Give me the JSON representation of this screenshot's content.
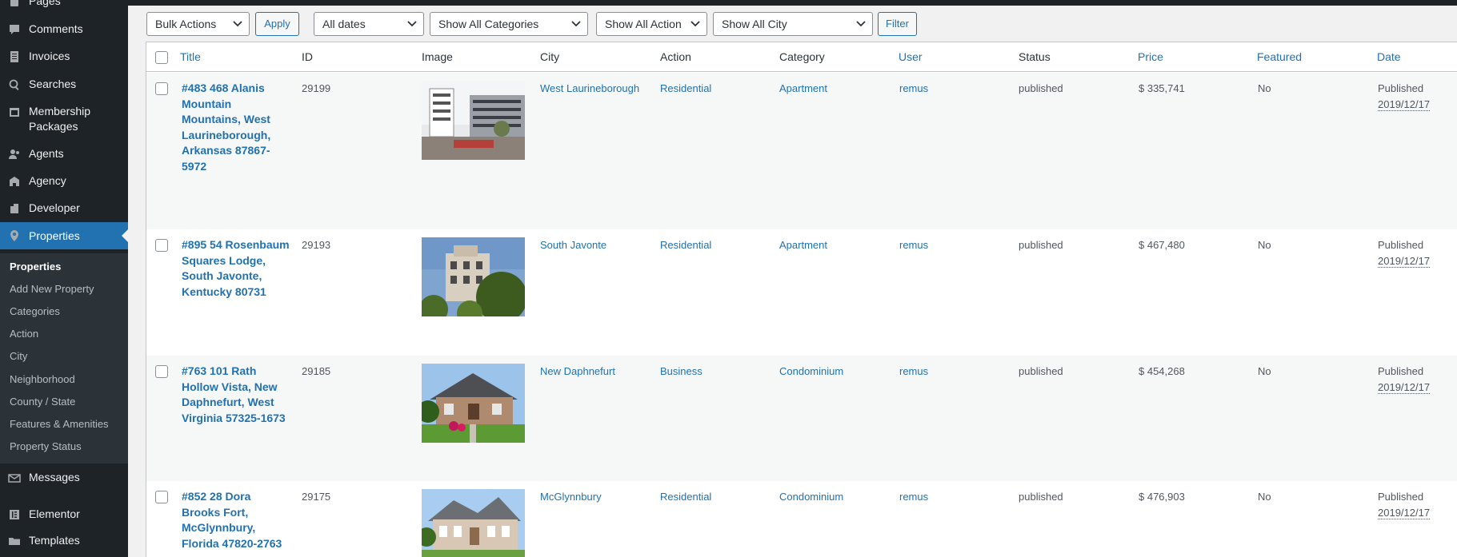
{
  "sidebar": {
    "items": [
      {
        "label": "Pages",
        "icon": "pages-icon"
      },
      {
        "label": "Comments",
        "icon": "comments-icon"
      },
      {
        "label": "Invoices",
        "icon": "invoices-icon"
      },
      {
        "label": "Searches",
        "icon": "search-icon"
      },
      {
        "label": "Membership Packages",
        "icon": "calendar-icon"
      },
      {
        "label": "Agents",
        "icon": "agents-icon"
      },
      {
        "label": "Agency",
        "icon": "agency-icon"
      },
      {
        "label": "Developer",
        "icon": "developer-icon"
      },
      {
        "label": "Properties",
        "icon": "location-pin-icon"
      },
      {
        "label": "Messages",
        "icon": "messages-icon"
      },
      {
        "label": "Elementor",
        "icon": "elementor-icon"
      },
      {
        "label": "Templates",
        "icon": "folder-icon"
      }
    ],
    "submenu": [
      "Properties",
      "Add New Property",
      "Categories",
      "Action",
      "City",
      "Neighborhood",
      "County / State",
      "Features & Amenities",
      "Property Status"
    ]
  },
  "toolbar": {
    "bulk_actions": "Bulk Actions",
    "apply": "Apply",
    "dates": "All dates",
    "categories": "Show All Categories",
    "action": "Show All Action",
    "city": "Show All City",
    "filter": "Filter"
  },
  "columns": {
    "title": "Title",
    "id": "ID",
    "image": "Image",
    "city": "City",
    "action": "Action",
    "category": "Category",
    "user": "User",
    "status": "Status",
    "price": "Price",
    "featured": "Featured",
    "date": "Date"
  },
  "rows": [
    {
      "title": "#483 468 Alanis Mountain Mountains, West Laurineborough, Arkansas 87867-5972",
      "id": "29199",
      "city": "West Laurineborough",
      "action": "Residential",
      "category": "Apartment",
      "user": "remus",
      "status": "published",
      "price": "$ 335,741",
      "featured": "No",
      "date_status": "Published",
      "date": "2019/12/17",
      "image": "modern-apartment-building"
    },
    {
      "title": "#895 54 Rosenbaum Squares Lodge, South Javonte, Kentucky 80731",
      "id": "29193",
      "city": "South Javonte",
      "action": "Residential",
      "category": "Apartment",
      "user": "remus",
      "status": "published",
      "price": "$ 467,480",
      "featured": "No",
      "date_status": "Published",
      "date": "2019/12/17",
      "image": "tower-building-with-trees"
    },
    {
      "title": "#763 101 Rath Hollow Vista, New Daphnefurt, West Virginia 57325-1673",
      "id": "29185",
      "city": "New Daphnefurt",
      "action": "Business",
      "category": "Condominium",
      "user": "remus",
      "status": "published",
      "price": "$ 454,268",
      "featured": "No",
      "date_status": "Published",
      "date": "2019/12/17",
      "image": "brick-house-with-lawn"
    },
    {
      "title": "#852 28 Dora Brooks Fort, McGlynnbury, Florida 47820-2763",
      "id": "29175",
      "city": "McGlynnbury",
      "action": "Residential",
      "category": "Condominium",
      "user": "remus",
      "status": "published",
      "price": "$ 476,903",
      "featured": "No",
      "date_status": "Published",
      "date": "2019/12/17",
      "image": "large-suburban-house"
    }
  ]
}
